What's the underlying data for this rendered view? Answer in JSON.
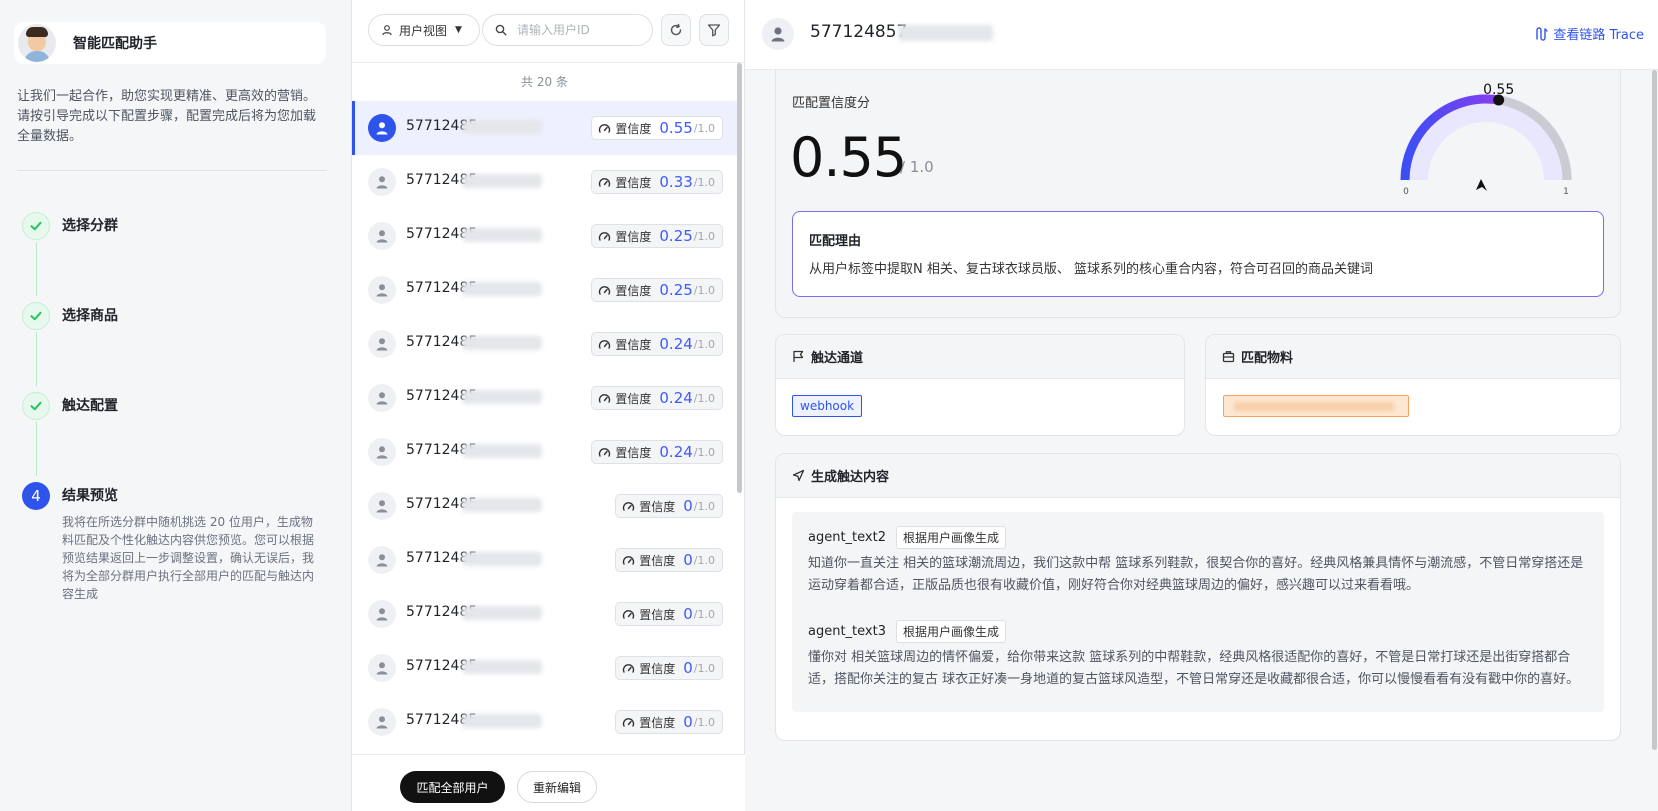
{
  "assistant": {
    "title": "智能匹配助手",
    "intro": "让我们一起合作，助您实现更精准、更高效的营销。请按引导完成以下配置步骤，配置完成后将为您加载全量数据。"
  },
  "steps": [
    {
      "title": "选择分群",
      "state": "done"
    },
    {
      "title": "选择商品",
      "state": "done"
    },
    {
      "title": "触达配置",
      "state": "done"
    },
    {
      "title": "结果预览",
      "state": "current",
      "number": "4",
      "desc": "我将在所选分群中随机挑选 20 位用户，生成物料匹配及个性化触达内容供您预览。您可以根据预览结果返回上一步调整设置，确认无误后，我将为全部分群用户执行全部用户的匹配与触达内容生成"
    }
  ],
  "toolbar": {
    "view_label": "用户视图",
    "search_placeholder": "请输入用户ID"
  },
  "list": {
    "total": "共 20 条",
    "badge_label": "置信度",
    "max_label": "/1.0",
    "rows": [
      {
        "id": "57712485",
        "score": "0.55",
        "selected": true
      },
      {
        "id": "57712485",
        "score": "0.33"
      },
      {
        "id": "57712485",
        "score": "0.25"
      },
      {
        "id": "57712485",
        "score": "0.25"
      },
      {
        "id": "57712485",
        "score": "0.24"
      },
      {
        "id": "57712485",
        "score": "0.24"
      },
      {
        "id": "57712485",
        "score": "0.24"
      },
      {
        "id": "57712485",
        "score": "0"
      },
      {
        "id": "57712485",
        "score": "0"
      },
      {
        "id": "57712485",
        "score": "0"
      },
      {
        "id": "57712485",
        "score": "0"
      },
      {
        "id": "57712485",
        "score": "0"
      }
    ]
  },
  "footer": {
    "match_all": "匹配全部用户",
    "re_edit": "重新编辑"
  },
  "detail": {
    "user_id": "577124857",
    "trace_label": "查看链路 Trace",
    "confidence_label": "匹配置信度分",
    "confidence_value": "0.55",
    "confidence_max": "/ 1.0",
    "gauge": {
      "value": 0.55,
      "value_label": "0.55",
      "min_label": "0",
      "max_label": "1"
    },
    "reason_title": "匹配理由",
    "reason_text": "从用户标签中提取N          相关、复古球衣球员版、       篮球系列的核心重合内容，符合可召回的商品关键词",
    "channel_title": "触达通道",
    "channel_tag": "webhook",
    "material_title": "匹配物料",
    "gen_title": "生成触达内容",
    "agents": [
      {
        "name": "agent_text2",
        "tag": "根据用户画像生成",
        "text": "知道你一直关注      相关的篮球潮流周边，我们这款中帮      篮球系列鞋款，很契合你的喜好。经典风格兼具情怀与潮流感，不管日常穿搭还是运动穿着都合适，正版品质也很有收藏价值，刚好符合你对经典篮球周边的偏好，感兴趣可以过来看看哦。"
      },
      {
        "name": "agent_text3",
        "tag": "根据用户画像生成",
        "text": "懂你对      相关篮球周边的情怀偏爱，给你带来这款      篮球系列的中帮鞋款，经典风格很适配你的喜好，不管是日常打球还是出街穿搭都合适，搭配你关注的复古      球衣正好凑一身地道的复古篮球风造型，不管日常穿还是收藏都很合适，你可以慢慢看看有没有戳中你的喜好。"
      }
    ]
  },
  "colors": {
    "accent": "#2f54eb",
    "gauge_fill": "#6a3df0",
    "reason_border": "#7c6cf0",
    "done_green": "#22c55e"
  }
}
